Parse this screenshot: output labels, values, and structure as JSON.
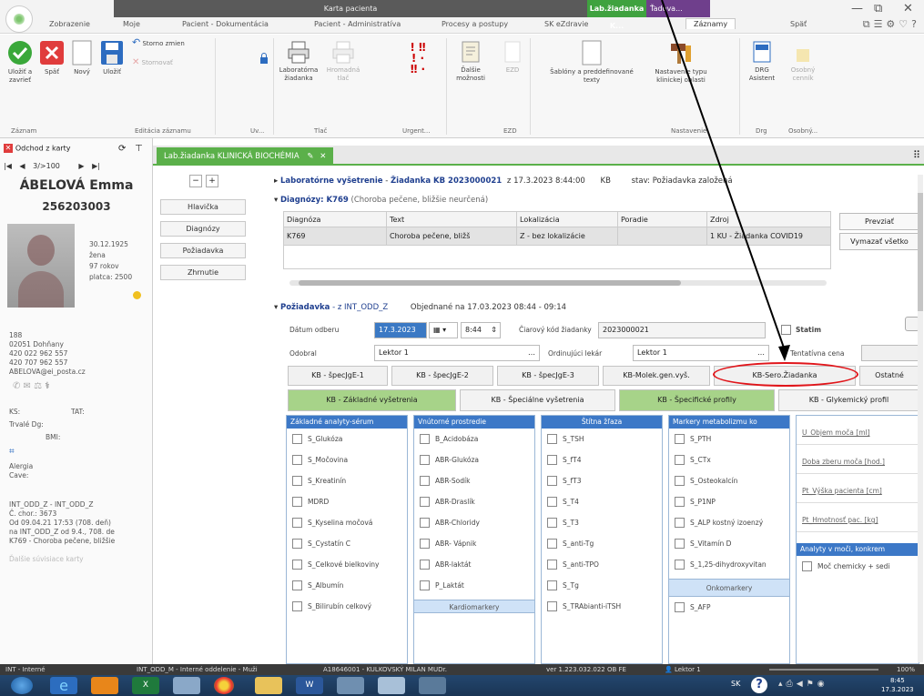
{
  "window": {
    "title": "Karta pacienta",
    "ctx_tab_1": "Lab.žiadanka K...",
    "ctx_tab_2": "Ťadova...",
    "controls": [
      "—",
      "⧉",
      "✕"
    ]
  },
  "menu": {
    "items": [
      "Zobrazenie",
      "Moje",
      "Pacient - Dokumentácia",
      "Pacient - Administratíva",
      "Procesy a postupy",
      "SK eZdravie",
      "Záznamy",
      "Späť"
    ],
    "active": "Záznamy"
  },
  "ribbon": {
    "buttons": {
      "ulozit_zavriet": "Uložiť a zavrieť",
      "spat": "Späť",
      "novy": "Nový",
      "ulozit": "Uložiť",
      "storno_zmien": "Storno zmien",
      "stornovat": "Stornovať",
      "lab_ziadanka": "Laboratórna žiadanka",
      "hromadna_tlac": "Hromadná tlač",
      "dalsie_moznosti": "Ďalšie možnosti",
      "ezd": "EZD",
      "sablony": "Šablóny a preddefinované texty",
      "nastavenie_typu": "Nastavenie typu klinickej oblasti",
      "drg_asistent": "DRG Asistent",
      "osobny_cenr": "Osobný cenník"
    },
    "groups": [
      "Záznam",
      "Editácia záznamu",
      "Uv...",
      "Tlač",
      "Urgent...",
      "EZD",
      "Nastavenie",
      "Drg",
      "Osobný..."
    ]
  },
  "patient": {
    "odchod": "Odchod z karty",
    "nav_position": "3/>100",
    "name": "ÁBELOVÁ Emma",
    "id": "256203003",
    "birth": "30.12.1925",
    "gender": "žena",
    "age": "97 rokov",
    "platca": "platca: 2500",
    "address": [
      "188",
      "02051  Dohňany",
      "420 022 962 557",
      "420 707 962 557",
      "ABELOVA@ei_posta.cz"
    ],
    "ks_label": "KS:",
    "tat_label": "TAT:",
    "trvale_dg": "Trvalé Dg:",
    "bmi": "BMI:",
    "alergie": "Alergia",
    "cave": "Cave:",
    "hosp": [
      "INT_ODD_Z - INT_ODD_Z",
      "Č. chor.: 3673",
      "Od 09.04.21 17:53 (708. deň)",
      "na INT_ODD_Z od 9.4., 708. de",
      "K769 - Choroba pečene, bližšie"
    ],
    "footer": "Ďalšie súvisiace karty"
  },
  "doc": {
    "tab_label": "Lab.žiadanka KLINICKÁ BIOCHÉMIA",
    "header": {
      "title_part": "Laboratórne vyšetrenie",
      "ziadanka": "Žiadanka KB 2023000021",
      "date": "z 17.3.2023 8:44:00",
      "kb": "KB",
      "stav": "stav: Požiadavka založená"
    },
    "left_nav": [
      "Hlavička",
      "Diagnózy",
      "Požiadavka",
      "Zhrnutie"
    ],
    "diag": {
      "title": "Diagnózy: K769",
      "subtitle": "(Choroba pečene, bližšie neurčená)",
      "columns": [
        "Diagnóza",
        "Text",
        "Lokalizácia",
        "Poradie",
        "Zdroj"
      ],
      "rows": [
        [
          "K769",
          "Choroba pečene, bližš",
          "Z - bez lokalizácie",
          "",
          "1 KU - Žiadanka COVID19"
        ]
      ],
      "btn_prevziat": "Prevziať",
      "btn_vymazat": "Vymazať všetko"
    },
    "poziadavka": {
      "title": "Požiadavka",
      "z": "- z INT_ODD_Z",
      "objednane": "Objednané na 17.03.2023 08:44 - 09:14",
      "datum_odberu_label": "Dátum odberu",
      "datum_odberu": "17.3.2023",
      "cas": "8:44",
      "ciarovy_kod_label": "Čiarový kód žiadanky",
      "ciarovy_kod": "2023000021",
      "statim": "Statim",
      "odobral_label": "Odobral",
      "odobral": "Lektor 1",
      "ordinujuci_label": "Ordinujúci lekár",
      "ordinujuci": "Lektor 1",
      "tentatrka_label": "Tentatívna cena"
    },
    "spec_tabs": [
      "KB - špecJgE-1",
      "KB - špecJgE-2",
      "KB - špecJgE-3",
      "KB-Molek.gen.vyš.",
      "KB-Sero.Žiadanka",
      "Ostatné"
    ],
    "group_tabs": [
      "KB - Základné vyšetrenia",
      "KB - Špeciálne vyšetrenia",
      "KB - Špecifické profily",
      "KB - Glykemický profil"
    ],
    "columns": [
      {
        "title": "Základné analyty-sérum",
        "items": [
          "S_Glukóza",
          "S_Močovina",
          "S_Kreatinín",
          "MDRD",
          "S_Kyselina močová",
          "S_Cystatín C",
          "S_Celkové bielkoviny",
          "S_Albumín",
          "S_Bilirubín celkový"
        ]
      },
      {
        "title": "Vnútorné prostredie",
        "items": [
          "B_Acidobáza",
          "ABR-Glukóza",
          "ABR-Sodík",
          "ABR-Draslík",
          "ABR-Chloridy",
          "ABR- Vápnik",
          "ABR-laktát",
          "P_Laktát"
        ],
        "subhead": "Kardiomarkery"
      },
      {
        "title": "Štítna žľaza",
        "items": [
          "S_TSH",
          "S_fT4",
          "S_fT3",
          "S_T4",
          "S_T3",
          "S_anti-Tg",
          "S_anti-TPO",
          "S_Tg",
          "S_TRAbianti-iTSH"
        ]
      },
      {
        "title": "Markery metabolizmu ko",
        "items": [
          "S_PTH",
          "S_CTx",
          "S_Osteokalcín",
          "S_P1NP",
          "S_ALP kostný izoenzý",
          "S_Vitamín D",
          "S_1,25-dihydroxyvitan"
        ],
        "subhead": "Onkomarkery",
        "items2": [
          "S_AFP"
        ]
      },
      {
        "title": "",
        "items": [
          "U_Objem moča [ml]",
          "Doba zberu moča [hod.]",
          "Pt_Výška pacienta [cm]",
          "Pt_Hmotnosť pac. [kg]"
        ],
        "subhead": "Analyty v moči, konkrem",
        "items2": [
          "Moč chemicky + sedi"
        ]
      }
    ]
  },
  "statusbar": [
    "INT - Interné",
    "INT_ODD_M - Interné oddelenie - Muži",
    "A18646001 - KULKOVSKÝ MILAN MUDr.",
    "ver 1.223.032.022 OB FE",
    "Lektor 1",
    "100%"
  ],
  "taskbar": {
    "lang": "SK",
    "time": "8:45",
    "date": "17.3.2023"
  },
  "colors": {
    "accent_green": "#5bb04a",
    "header_blue": "#3c78c7",
    "annotation_red": "#e0151a"
  }
}
